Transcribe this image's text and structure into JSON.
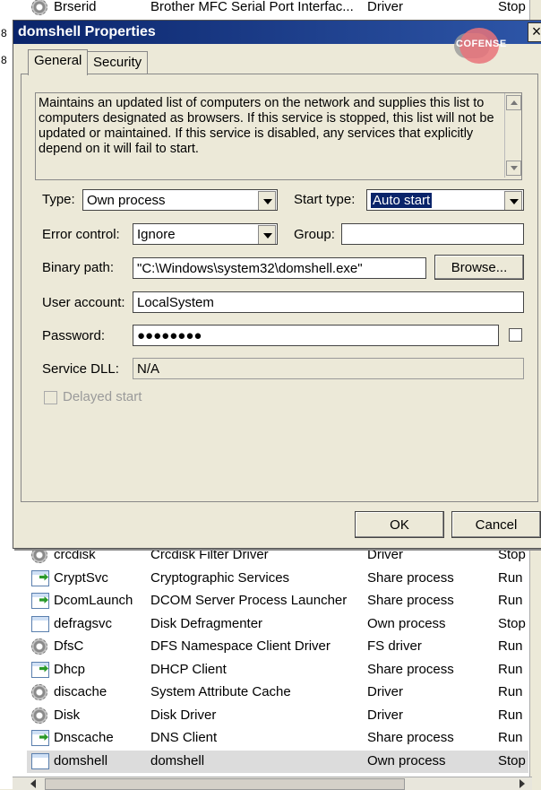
{
  "left_strip": {
    "numbers": [
      "8",
      "8"
    ]
  },
  "top_row": {
    "name": "Brserid",
    "display": "Brother MFC Serial Port Interfac...",
    "type": "Driver",
    "status": "Stop"
  },
  "dialog": {
    "title": "domshell Properties",
    "watermark": "COFENSE",
    "close_glyph": "×",
    "tabs": [
      "General",
      "Security"
    ],
    "description": "Maintains an updated list of computers on the network and supplies this list to computers designated as browsers. If this service is stopped, this list will not be updated or maintained. If this service is disabled, any services that explicitly depend on it will fail to start.",
    "type_label": "Type:",
    "type_value": "Own process",
    "start_type_label": "Start type:",
    "start_type_value": "Auto start",
    "error_control_label": "Error control:",
    "error_control_value": "Ignore",
    "group_label": "Group:",
    "group_value": "",
    "binary_path_label": "Binary path:",
    "binary_path_value": "\"C:\\Windows\\system32\\domshell.exe\"",
    "browse_label": "Browse...",
    "user_account_label": "User account:",
    "user_account_value": "LocalSystem",
    "password_label": "Password:",
    "password_value": "●●●●●●●●",
    "service_dll_label": "Service DLL:",
    "service_dll_value": "N/A",
    "delayed_start_label": "Delayed start",
    "ok_label": "OK",
    "cancel_label": "Cancel"
  },
  "services": [
    {
      "name": "crcdisk",
      "display": "Crcdisk Filter Driver",
      "type": "Driver",
      "status": "Stop",
      "icon": "gear"
    },
    {
      "name": "CryptSvc",
      "display": "Cryptographic Services",
      "type": "Share process",
      "status": "Run",
      "icon": "window-arrow"
    },
    {
      "name": "DcomLaunch",
      "display": "DCOM Server Process Launcher",
      "type": "Share process",
      "status": "Run",
      "icon": "window-arrow"
    },
    {
      "name": "defragsvc",
      "display": "Disk Defragmenter",
      "type": "Own process",
      "status": "Stop",
      "icon": "window"
    },
    {
      "name": "DfsC",
      "display": "DFS Namespace Client Driver",
      "type": "FS driver",
      "status": "Run",
      "icon": "gear"
    },
    {
      "name": "Dhcp",
      "display": "DHCP Client",
      "type": "Share process",
      "status": "Run",
      "icon": "window-arrow"
    },
    {
      "name": "discache",
      "display": "System Attribute Cache",
      "type": "Driver",
      "status": "Run",
      "icon": "gear"
    },
    {
      "name": "Disk",
      "display": "Disk Driver",
      "type": "Driver",
      "status": "Run",
      "icon": "gear"
    },
    {
      "name": "Dnscache",
      "display": "DNS Client",
      "type": "Share process",
      "status": "Run",
      "icon": "window-arrow"
    },
    {
      "name": "domshell",
      "display": "domshell",
      "type": "Own process",
      "status": "Stop",
      "icon": "window"
    }
  ]
}
